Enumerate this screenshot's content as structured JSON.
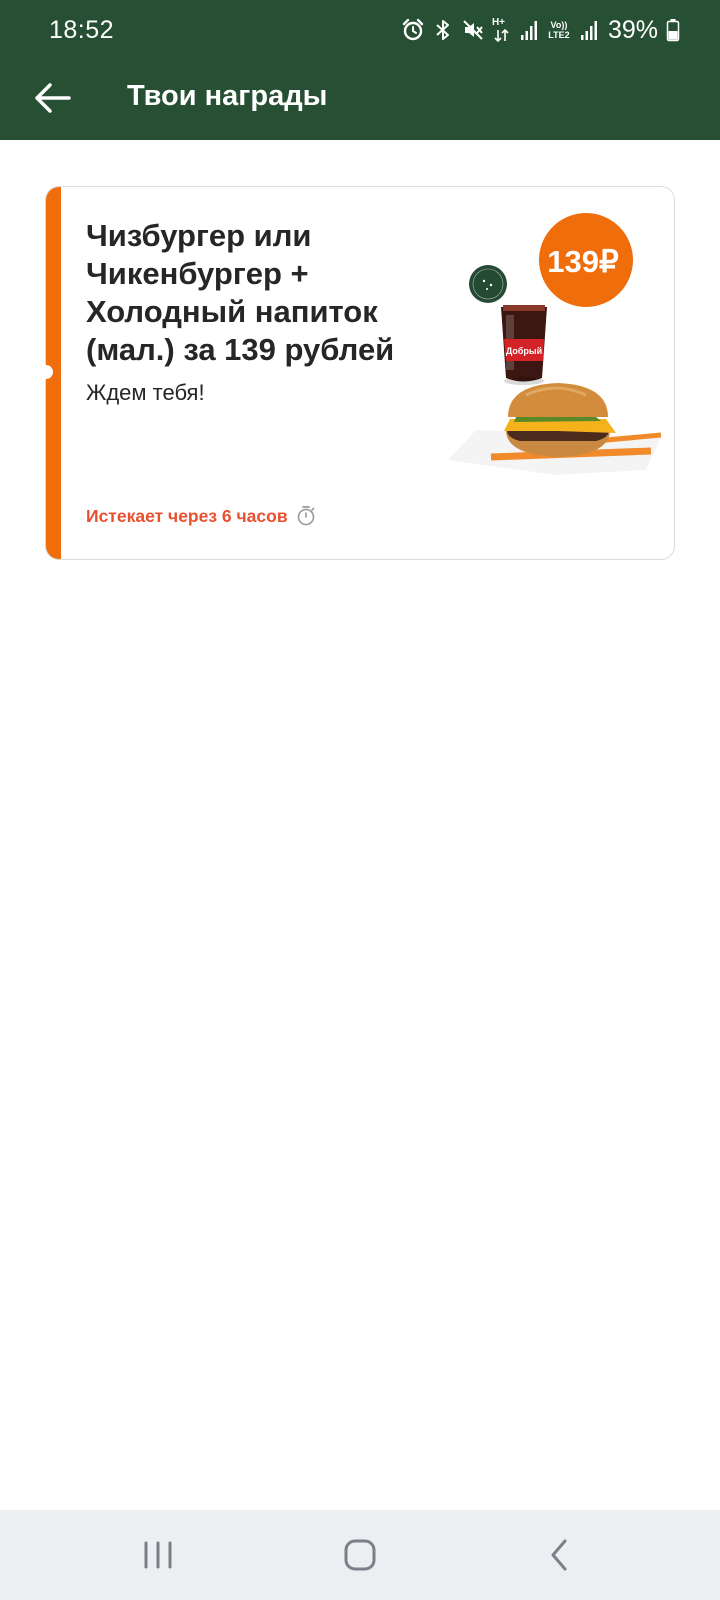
{
  "status_bar": {
    "time": "18:52",
    "icons": [
      "alarm-icon",
      "bluetooth-icon",
      "mute-icon",
      "data-arrows-icon",
      "signal-icon",
      "volte-lte2-icon",
      "signal-icon",
      "battery-icon"
    ],
    "hplus": "H+",
    "volte_line1": "Vo))",
    "volte_line2": "LTE2",
    "battery": "39%"
  },
  "app_bar": {
    "title": "Твои награды",
    "back_icon": "arrow-left-icon"
  },
  "reward_card": {
    "title": "Чизбургер или Чикенбургер + Холодный напиток (мал.) за 139 рублей",
    "subtitle": "Ждем тебя!",
    "expiry": "Истекает через 6 часов",
    "expiry_icon": "stopwatch-icon",
    "price_badge": "139₽",
    "cup_label": "Добрый",
    "stamp_text": "ГАЗИРОВАННЫЙ НАПИТОК",
    "colors": {
      "accent": "#f06d0c",
      "expiry": "#e8502f",
      "header": "#264f33"
    }
  },
  "nav_bar": {
    "recents_icon": "recents-icon",
    "home_icon": "home-icon",
    "back_icon": "nav-back-icon"
  }
}
